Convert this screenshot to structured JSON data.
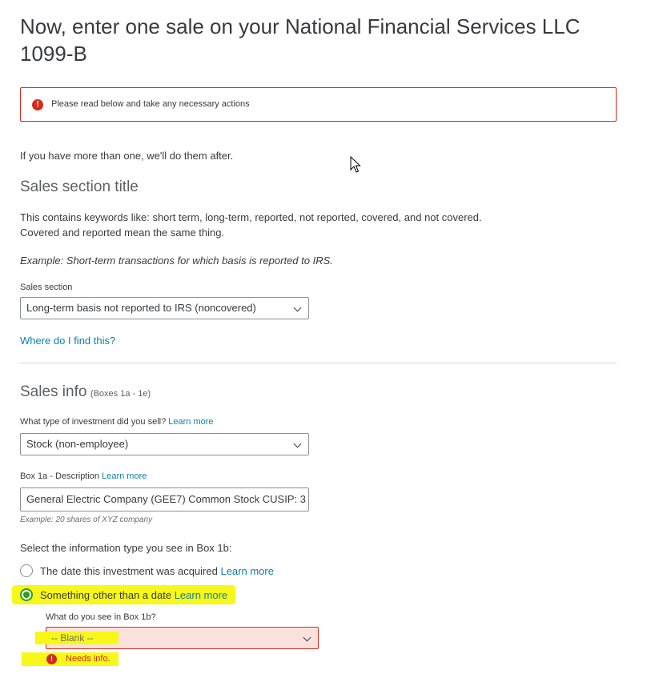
{
  "page": {
    "title": "Now, enter one sale on your National Financial Services LLC 1099-B"
  },
  "alert": {
    "text": "Please read below and take any necessary actions"
  },
  "intro": {
    "text": "If you have more than one, we'll do them after."
  },
  "sales_section": {
    "title": "Sales section title",
    "description_line1": "This contains keywords like: short term, long-term, reported, not reported, covered, and not covered.",
    "description_line2": "Covered and reported mean the same thing.",
    "example": "Example: Short-term transactions for which basis is reported to IRS.",
    "field_label": "Sales section",
    "selected_value": "Long-term basis not reported to IRS (noncovered)",
    "help_link": "Where do I find this?"
  },
  "sales_info": {
    "title": "Sales info",
    "subtitle": "(Boxes 1a - 1e)",
    "investment_type_label": "What type of investment did you sell?",
    "investment_type_learn_more": "Learn more",
    "investment_type_value": "Stock (non-employee)",
    "box1a_label": "Box 1a - Description",
    "box1a_learn_more": "Learn more",
    "box1a_value": "General Electric Company (GEE7) Common Stock CUSIP: 3",
    "box1a_example": "Example: 20 shares of XYZ company",
    "box1b_question": "Select the information type you see in Box 1b:",
    "radio_options": [
      {
        "label": "The date this investment was acquired",
        "learn_more": "Learn more",
        "checked": false
      },
      {
        "label": "Something other than a date",
        "learn_more": "Learn more",
        "checked": true
      }
    ],
    "box1b_sub_label": "What do you see in Box 1b?",
    "box1b_sub_value": "-- Blank --",
    "error_text": "Needs info."
  },
  "colors": {
    "error": "#d52b1e",
    "link": "#0d7fa6",
    "radio_checked": "#2ca01c",
    "highlight": "#f7f71a"
  },
  "icons": {
    "alert": "exclamation-circle-icon",
    "dropdown": "chevron-down-icon",
    "cursor": "mouse-pointer-icon"
  }
}
